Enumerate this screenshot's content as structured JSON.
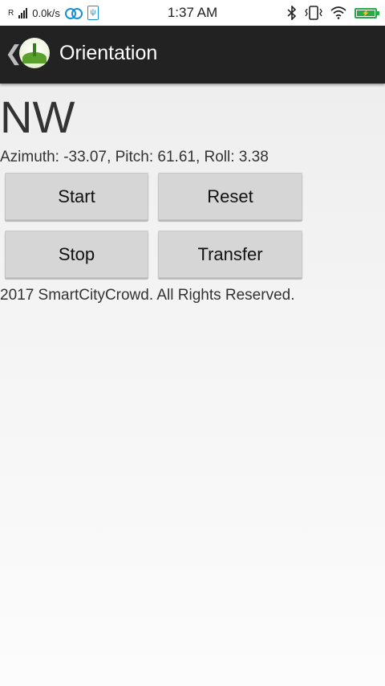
{
  "status_bar": {
    "carrier_mark": "R",
    "net_speed": "0.0k/s",
    "time": "1:37 AM",
    "icons": [
      "signal-icon",
      "voicemail-icon",
      "usb-icon",
      "bluetooth-icon",
      "vibrate-icon",
      "wifi-icon",
      "battery-icon"
    ],
    "battery_level": 1.0
  },
  "app_bar": {
    "back_glyph": "❮",
    "title": "Orientation"
  },
  "main": {
    "direction": "NW",
    "readout": "Azimuth: -33.07, Pitch: 61.61, Roll: 3.38",
    "buttons": {
      "start": "Start",
      "reset": "Reset",
      "stop": "Stop",
      "transfer": "Transfer"
    },
    "footer": "2017 SmartCityCrowd. All Rights Reserved."
  },
  "colors": {
    "app_bar_bg": "#222222",
    "button_bg": "#d6d6d6",
    "status_accent": "#1a8fd0",
    "battery_green": "#2aa84a"
  }
}
